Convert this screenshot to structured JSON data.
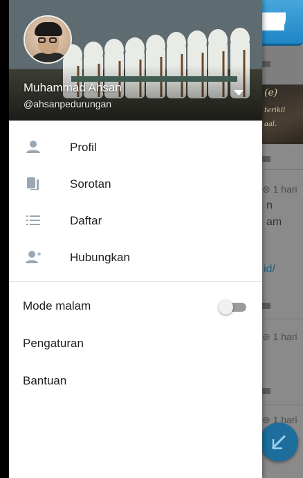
{
  "background_timeline": {
    "time_1": "1 hari",
    "line_a": "n",
    "line_b": "am",
    "link": "id/",
    "time_2": "1 hari",
    "time_3": "1 hari",
    "photo_text_1": "(e)",
    "photo_text_2": "terikil",
    "photo_text_3": "aal."
  },
  "drawer": {
    "profile": {
      "name": "Muhammad Ahsan",
      "handle": "@ahsanpedurungan"
    },
    "menu": [
      {
        "label": "Profil",
        "icon": "person-icon"
      },
      {
        "label": "Sorotan",
        "icon": "moments-icon"
      },
      {
        "label": "Daftar",
        "icon": "list-icon"
      },
      {
        "label": "Hubungkan",
        "icon": "add-person-icon"
      }
    ],
    "settings": [
      {
        "label": "Mode malam",
        "toggle": false
      },
      {
        "label": "Pengaturan"
      },
      {
        "label": "Bantuan"
      }
    ]
  },
  "colors": {
    "accent": "#1da1f2",
    "icon": "#9aa7b4",
    "text": "#1f1f1f",
    "overlay": "#8a8a8a"
  }
}
